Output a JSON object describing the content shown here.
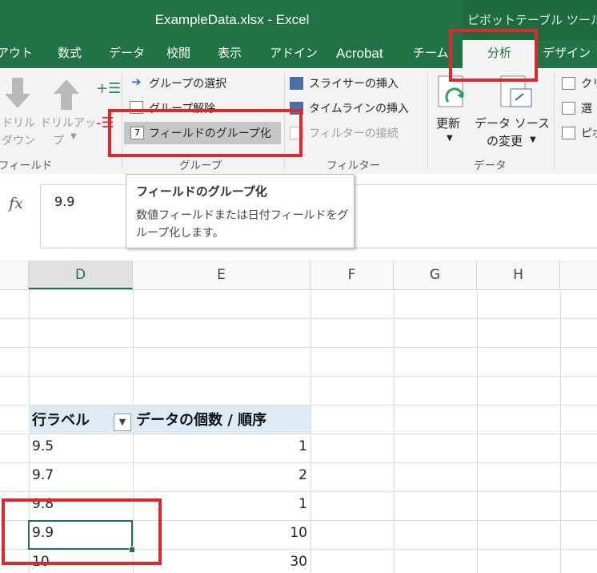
{
  "title_bar": {
    "app_title": "ExampleData.xlsx - Excel",
    "context_title": "ピボットテーブル ツール"
  },
  "tabs": [
    {
      "label": "アウト"
    },
    {
      "label": "数式"
    },
    {
      "label": "データ"
    },
    {
      "label": "校閲"
    },
    {
      "label": "表示"
    },
    {
      "label": "アドイン"
    },
    {
      "label": "Acrobat"
    },
    {
      "label": "チーム"
    },
    {
      "label": "分析"
    },
    {
      "label": "デザイン"
    }
  ],
  "ribbon": {
    "active_field": {
      "drilldown_1": "ドリル",
      "drilldown_2": "ダウン",
      "drillup_1": "ドリルアッ",
      "drillup_2": "プ",
      "group_label": "フィールド"
    },
    "group": {
      "group_selection": "グループの選択",
      "ungroup": "グループ解除",
      "group_field": "フィールドのグループ化",
      "group_label": "グループ"
    },
    "filter": {
      "insert_slicer": "スライサーの挿入",
      "insert_timeline": "タイムラインの挿入",
      "filter_connections": "フィルターの接続",
      "group_label": "フィルター"
    },
    "data": {
      "refresh": "更新",
      "change_source_1": "データ ソース",
      "change_source_2": "の変更",
      "group_label": "データ"
    },
    "actions": {
      "clear": "クリ",
      "select": "選",
      "pivot": "ピボ"
    }
  },
  "tooltip": {
    "title": "フィールドのグループ化",
    "description": "数値フィールドまたは日付フィールドをグループ化します。"
  },
  "formula_bar": {
    "fx": "fx",
    "value": "9.9"
  },
  "columns": [
    "D",
    "E",
    "F",
    "G",
    "H"
  ],
  "pivot": {
    "row_label_header": "行ラベル",
    "value_header": "データの個数 / 順序",
    "rows": [
      {
        "label": "9.5",
        "count": "1"
      },
      {
        "label": "9.7",
        "count": "2"
      },
      {
        "label": "9.8",
        "count": "1"
      },
      {
        "label": "9.9",
        "count": "10"
      },
      {
        "label": "10",
        "count": "30"
      }
    ]
  },
  "highlight_color": "#e0282c",
  "accent_color": "#217346"
}
